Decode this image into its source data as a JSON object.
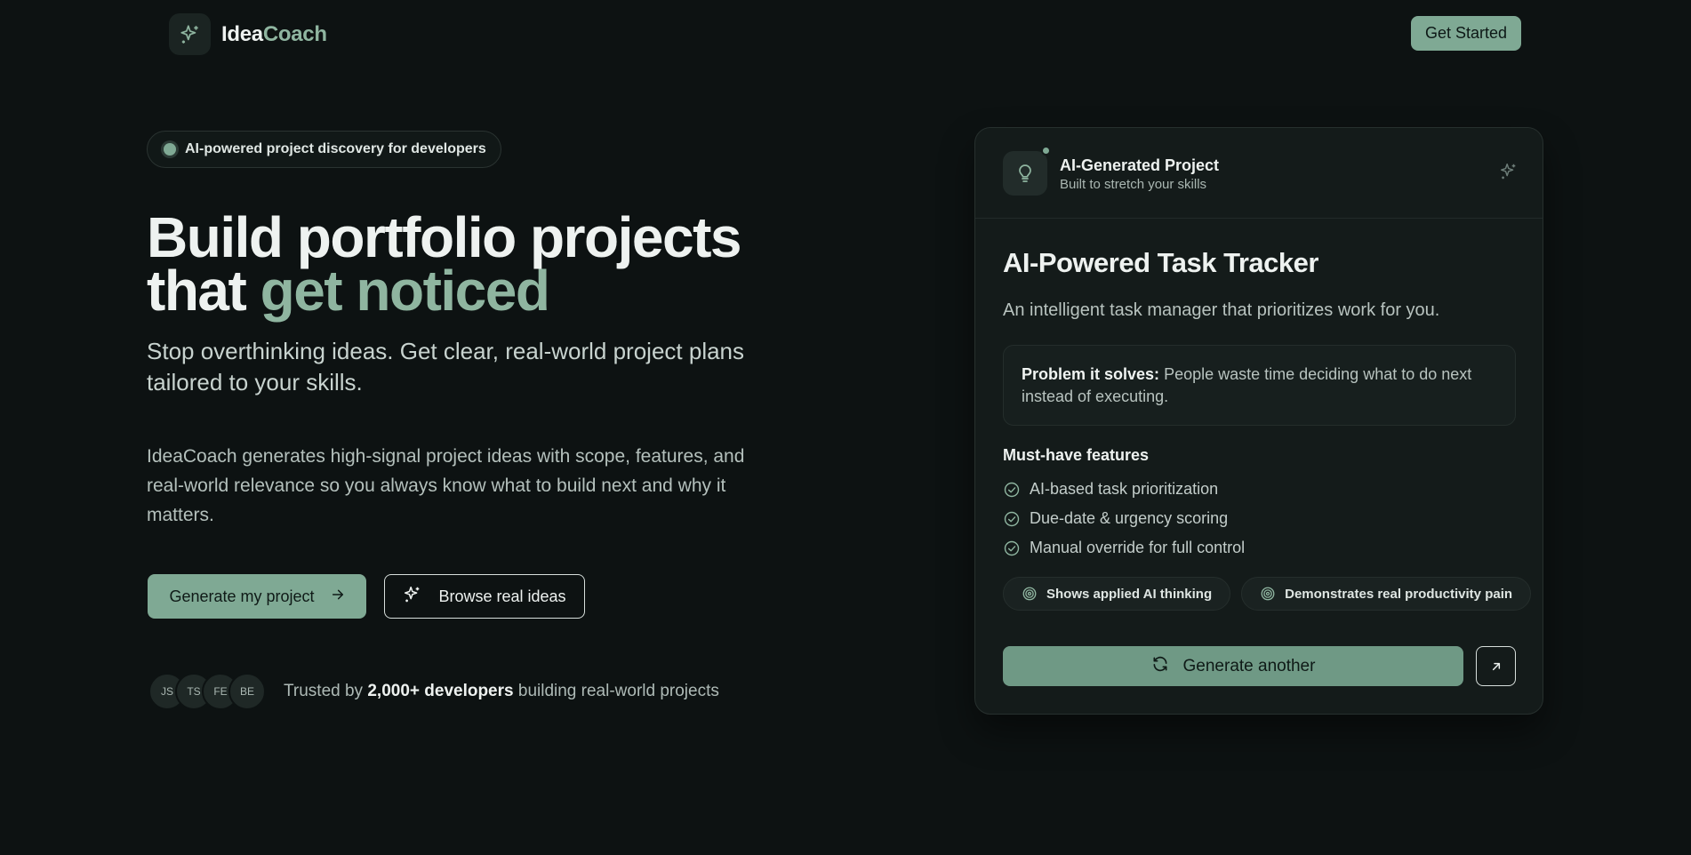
{
  "header": {
    "logo_icon": "sparkles-icon",
    "brand_part1": "Idea",
    "brand_part2": "Coach",
    "cta_label": "Get Started"
  },
  "hero": {
    "pill_text": "AI-powered project discovery for developers",
    "title_line1": "Build portfolio projects",
    "title_line2_plain": "that ",
    "title_line2_accent": "get noticed",
    "subtitle": "Stop overthinking ideas. Get clear, real-world project plans tailored to your skills.",
    "description": "IdeaCoach generates high-signal project ideas with scope, features, and real-world relevance so you always know what to build next and why it matters.",
    "primary_button": "Generate my project",
    "secondary_button": "Browse real ideas",
    "avatars": [
      "JS",
      "TS",
      "FE",
      "BE"
    ],
    "trusted_prefix": "Trusted by ",
    "trusted_bold": "2,000+ developers",
    "trusted_suffix": " building real-world projects"
  },
  "card": {
    "header_title": "AI-Generated Project",
    "header_subtitle": "Built to stretch your skills",
    "project_title": "AI-Powered Task Tracker",
    "tagline": "An intelligent task manager that prioritizes work for you.",
    "problem_label": "Problem it solves:",
    "problem_text": " People waste time deciding what to do next instead of executing.",
    "features_label": "Must-have features",
    "features": [
      "AI-based task prioritization",
      "Due-date & urgency scoring",
      "Manual override for full control"
    ],
    "tags": [
      "Shows applied AI thinking",
      "Demonstrates real productivity pain"
    ],
    "generate_button": "Generate another"
  },
  "colors": {
    "background": "#0d1212",
    "accent": "#7fa994",
    "accent_text": "#8fb5a0",
    "card_bg": "#141b1a"
  }
}
